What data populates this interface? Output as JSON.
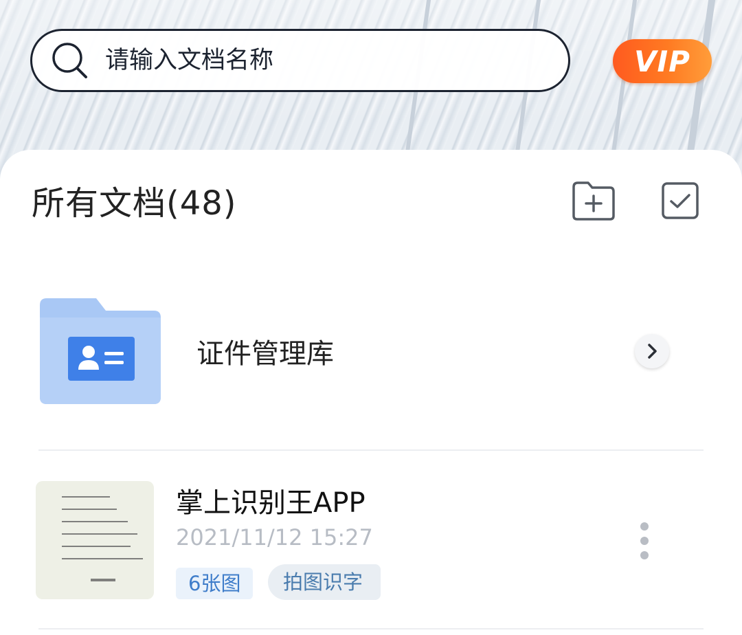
{
  "search": {
    "placeholder": "请输入文档名称"
  },
  "vip_label": "VIP",
  "section": {
    "title": "所有文档(48)"
  },
  "folder": {
    "label": "证件管理库"
  },
  "documents": [
    {
      "title": "掌上识别王APP",
      "timestamp": "2021/11/12 15:27",
      "tags": [
        "6张图",
        "拍图识字"
      ]
    }
  ],
  "icons": {
    "search": "search-icon",
    "new_folder": "folder-plus-icon",
    "select": "checkbox-icon",
    "folder": "id-card-folder-icon",
    "chevron": "chevron-right-icon",
    "more": "more-vertical-icon"
  },
  "colors": {
    "vip_accent": "#ff6a1f",
    "folder_blue": "#a9c8f5",
    "card_blue": "#3f80e8",
    "tag_blue": "#3f7dca"
  }
}
